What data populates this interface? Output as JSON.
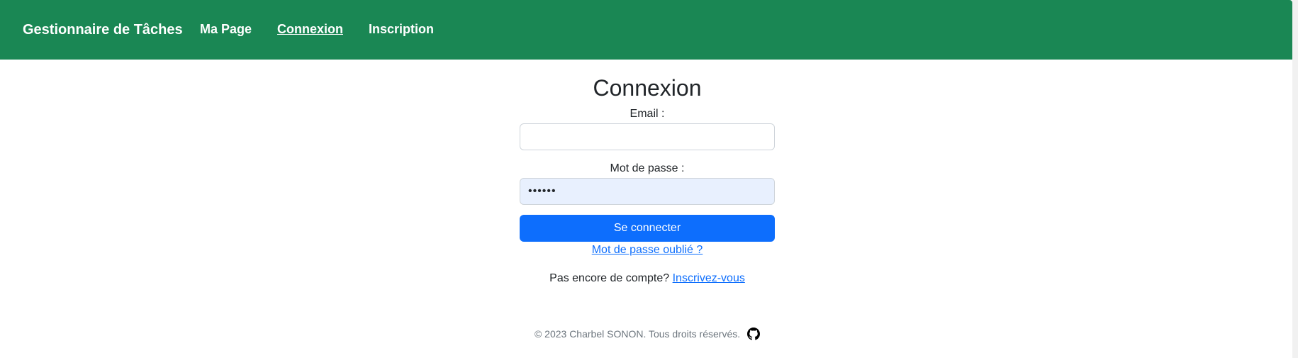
{
  "navbar": {
    "brand": "Gestionnaire de Tâches",
    "links": [
      {
        "label": "Ma Page"
      },
      {
        "label": "Connexion"
      },
      {
        "label": "Inscription"
      }
    ],
    "background": "#1a8754"
  },
  "login": {
    "title": "Connexion",
    "email_label": "Email :",
    "email_value": "",
    "password_label": "Mot de passe :",
    "password_value": "••••••",
    "submit_label": "Se connecter",
    "forgot_label": "Mot de passe oublié ?",
    "signup_prompt": "Pas encore de compte?",
    "signup_link": "Inscrivez-vous",
    "button_color": "#0d6efd"
  },
  "footer": {
    "text": "© 2023 Charbel SONON. Tous droits réservés.",
    "icon": "github-icon"
  }
}
